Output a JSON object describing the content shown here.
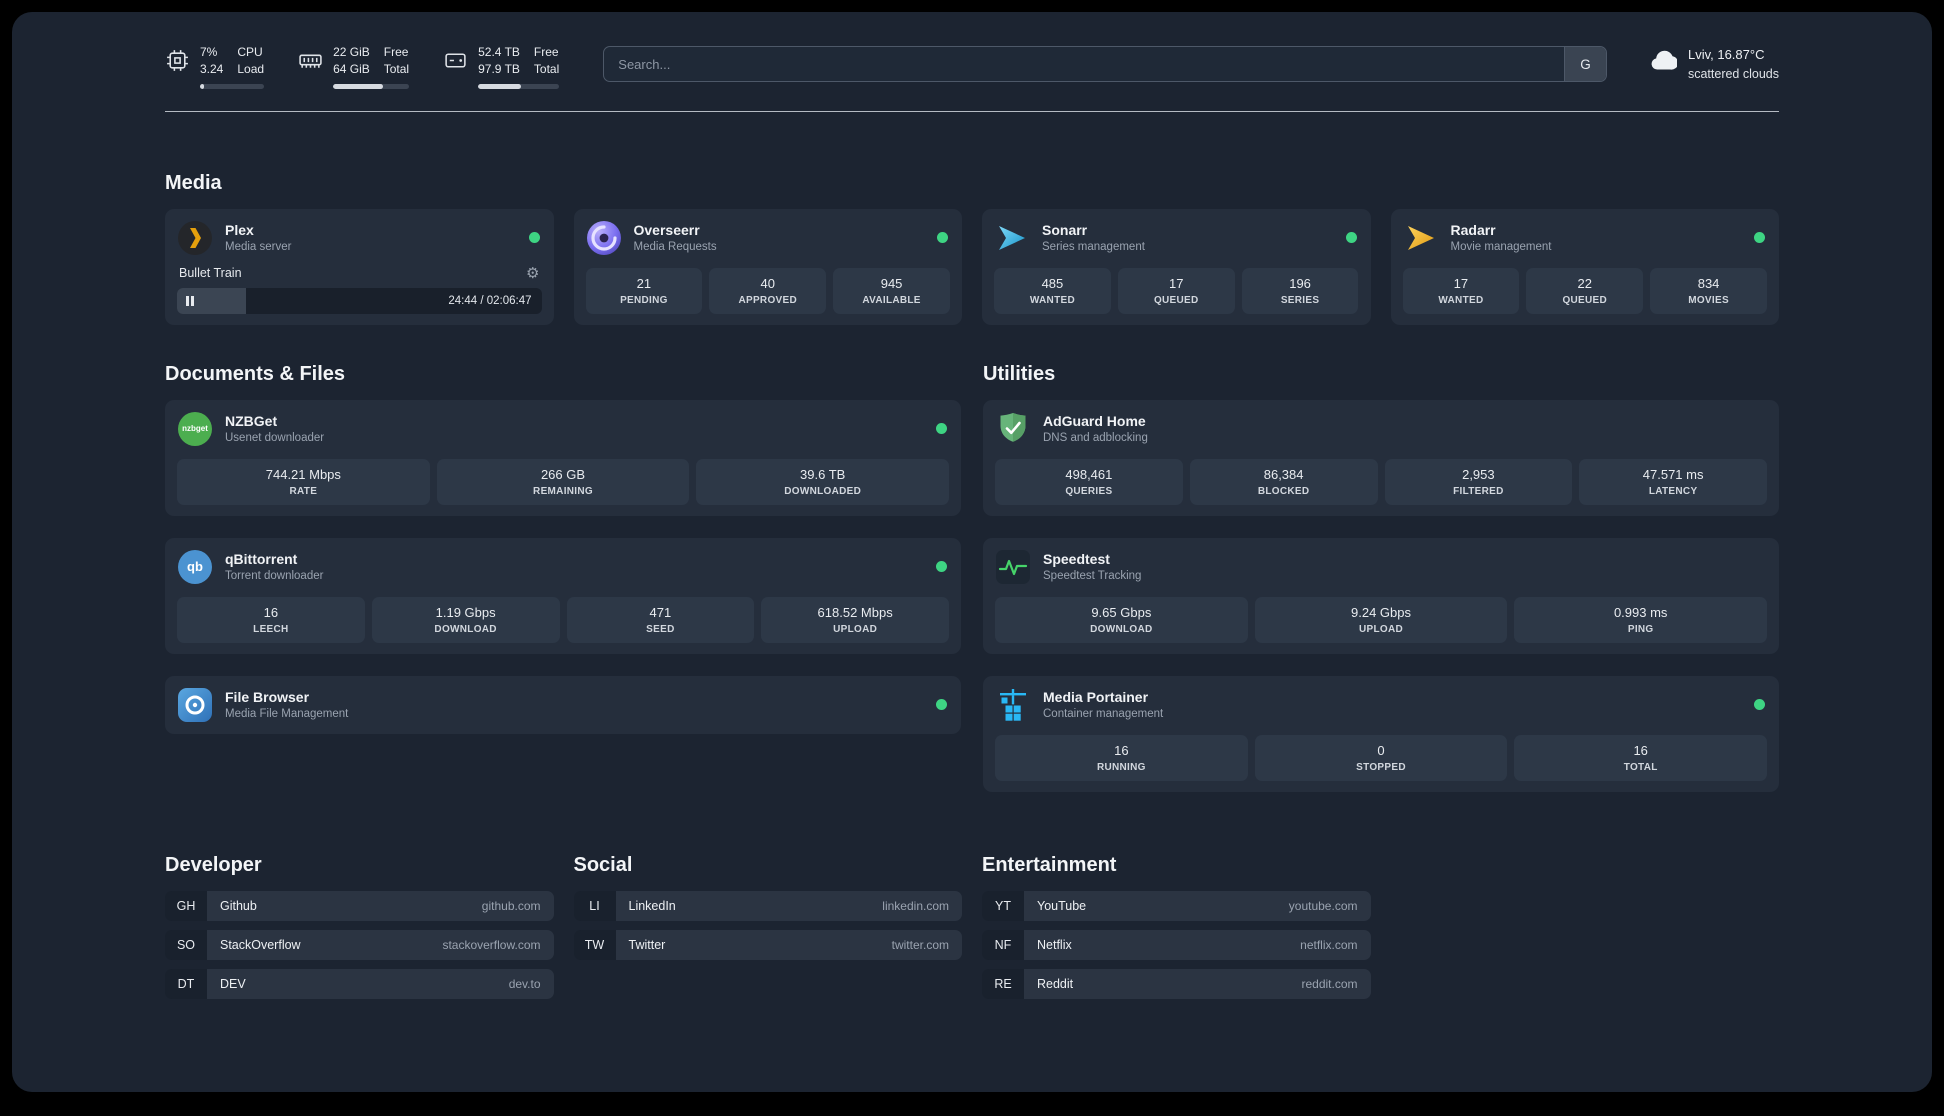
{
  "theme": {
    "background": "#1c2431",
    "card": "#252e3c",
    "tile": "#2d3847",
    "status_online": "#3ed483"
  },
  "icons": {
    "gear": "⚙"
  },
  "topbar": {
    "resources": [
      {
        "icon": "cpu-icon",
        "values": [
          "7%",
          "3.24"
        ],
        "labels": [
          "CPU",
          "Load"
        ],
        "bar_percent": 7
      },
      {
        "icon": "memory-icon",
        "values": [
          "22 GiB",
          "64 GiB"
        ],
        "labels": [
          "Free",
          "Total"
        ],
        "bar_percent": 66
      },
      {
        "icon": "disk-icon",
        "values": [
          "52.4 TB",
          "97.9 TB"
        ],
        "labels": [
          "Free",
          "Total"
        ],
        "bar_percent": 53
      }
    ],
    "search": {
      "placeholder": "Search...",
      "provider_button": "G"
    },
    "weather": {
      "location": "Lviv, 16.87°C",
      "condition": "scattered clouds"
    }
  },
  "media": {
    "title": "Media",
    "cards": [
      {
        "name": "Plex",
        "description": "Media server",
        "status": "online",
        "player": {
          "track": "Bullet Train",
          "time": "24:44 / 02:06:47",
          "progress_percent": 19
        }
      },
      {
        "name": "Overseerr",
        "description": "Media Requests",
        "status": "online",
        "stats": [
          {
            "value": "21",
            "label": "PENDING"
          },
          {
            "value": "40",
            "label": "APPROVED"
          },
          {
            "value": "945",
            "label": "AVAILABLE"
          }
        ]
      },
      {
        "name": "Sonarr",
        "description": "Series management",
        "status": "online",
        "stats": [
          {
            "value": "485",
            "label": "WANTED"
          },
          {
            "value": "17",
            "label": "QUEUED"
          },
          {
            "value": "196",
            "label": "SERIES"
          }
        ]
      },
      {
        "name": "Radarr",
        "description": "Movie management",
        "status": "online",
        "stats": [
          {
            "value": "17",
            "label": "WANTED"
          },
          {
            "value": "22",
            "label": "QUEUED"
          },
          {
            "value": "834",
            "label": "MOVIES"
          }
        ]
      }
    ]
  },
  "documents": {
    "title": "Documents & Files",
    "cards": [
      {
        "name": "NZBGet",
        "description": "Usenet downloader",
        "status": "online",
        "icon_text": "nzbget",
        "stats": [
          {
            "value": "744.21 Mbps",
            "label": "RATE"
          },
          {
            "value": "266 GB",
            "label": "REMAINING"
          },
          {
            "value": "39.6 TB",
            "label": "DOWNLOADED"
          }
        ]
      },
      {
        "name": "qBittorrent",
        "description": "Torrent downloader",
        "status": "online",
        "icon_text": "qb",
        "stats": [
          {
            "value": "16",
            "label": "LEECH"
          },
          {
            "value": "1.19 Gbps",
            "label": "DOWNLOAD"
          },
          {
            "value": "471",
            "label": "SEED"
          },
          {
            "value": "618.52 Mbps",
            "label": "UPLOAD"
          }
        ]
      },
      {
        "name": "File Browser",
        "description": "Media File Management",
        "status": "online"
      }
    ]
  },
  "utilities": {
    "title": "Utilities",
    "cards": [
      {
        "name": "AdGuard Home",
        "description": "DNS and adblocking",
        "stats": [
          {
            "value": "498,461",
            "label": "QUERIES"
          },
          {
            "value": "86,384",
            "label": "BLOCKED"
          },
          {
            "value": "2,953",
            "label": "FILTERED"
          },
          {
            "value": "47.571 ms",
            "label": "LATENCY"
          }
        ]
      },
      {
        "name": "Speedtest",
        "description": "Speedtest Tracking",
        "stats": [
          {
            "value": "9.65 Gbps",
            "label": "DOWNLOAD"
          },
          {
            "value": "9.24 Gbps",
            "label": "UPLOAD"
          },
          {
            "value": "0.993 ms",
            "label": "PING"
          }
        ]
      },
      {
        "name": "Media Portainer",
        "description": "Container management",
        "status": "online",
        "stats": [
          {
            "value": "16",
            "label": "RUNNING"
          },
          {
            "value": "0",
            "label": "STOPPED"
          },
          {
            "value": "16",
            "label": "TOTAL"
          }
        ]
      }
    ]
  },
  "bookmarks": [
    {
      "title": "Developer",
      "links": [
        {
          "abbr": "GH",
          "name": "Github",
          "url": "github.com"
        },
        {
          "abbr": "SO",
          "name": "StackOverflow",
          "url": "stackoverflow.com"
        },
        {
          "abbr": "DT",
          "name": "DEV",
          "url": "dev.to"
        }
      ]
    },
    {
      "title": "Social",
      "links": [
        {
          "abbr": "LI",
          "name": "LinkedIn",
          "url": "linkedin.com"
        },
        {
          "abbr": "TW",
          "name": "Twitter",
          "url": "twitter.com"
        }
      ]
    },
    {
      "title": "Entertainment",
      "links": [
        {
          "abbr": "YT",
          "name": "YouTube",
          "url": "youtube.com"
        },
        {
          "abbr": "NF",
          "name": "Netflix",
          "url": "netflix.com"
        },
        {
          "abbr": "RE",
          "name": "Reddit",
          "url": "reddit.com"
        }
      ]
    }
  ]
}
